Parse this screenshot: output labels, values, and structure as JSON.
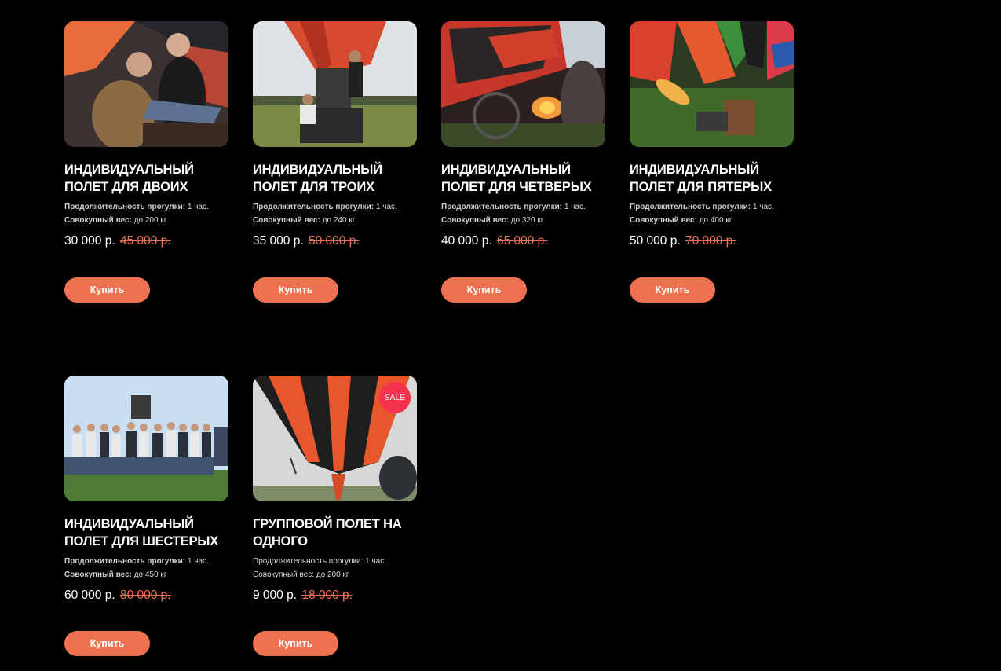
{
  "products": [
    {
      "title": "Индивидуальный полет для двоих",
      "duration_label": "Продолжительность прогулки:",
      "duration": "1 час.",
      "weight_label": "Совокупный вес:",
      "weight": "до 200 кг",
      "price": "30 000 р.",
      "old_price": "45 000 р.",
      "button": "Купить"
    },
    {
      "title": "Индивидуальный полет для троих",
      "duration_label": "Продолжительность прогулки:",
      "duration": "1 час.",
      "weight_label": "Совокупный вес:",
      "weight": "до 240 кг",
      "price": "35 000 р.",
      "old_price": "50 000 р.",
      "button": "Купить"
    },
    {
      "title": "Индивидуальный полет для четверых",
      "duration_label": "Продолжительность прогулки:",
      "duration": "1 час.",
      "weight_label": "Совокупный вес:",
      "weight": "до 320 кг",
      "price": "40 000 р.",
      "old_price": "65 000 р.",
      "button": "Купить"
    },
    {
      "title": "Индивидуальный полет для пятерых",
      "duration_label": "Продолжительность прогулки:",
      "duration": "1 час.",
      "weight_label": "Совокупный вес:",
      "weight": "до 400 кг",
      "price": "50 000 р.",
      "old_price": "70 000 р.",
      "button": "Купить"
    },
    {
      "title": "Индивидуальный полет для шестерых",
      "duration_label": "Продолжительность прогулки:",
      "duration": "1 час.",
      "weight_label": "Совокупный вес:",
      "weight": "до 450 кг",
      "price": "60 000 р.",
      "old_price": "80 000 р.",
      "button": "Купить"
    },
    {
      "title": "Групповой полет на одного",
      "duration_label": "Продолжительность прогулки:",
      "duration": "1 час.",
      "weight_label": "Совокупный вес:",
      "weight": "до 200 кг",
      "price": "9 000 р.",
      "old_price": "18 000 р.",
      "button": "Купить",
      "badge": "SALE"
    }
  ],
  "colors": {
    "accent": "#ef7250",
    "sale_badge": "#f4344f",
    "background": "#000000"
  }
}
